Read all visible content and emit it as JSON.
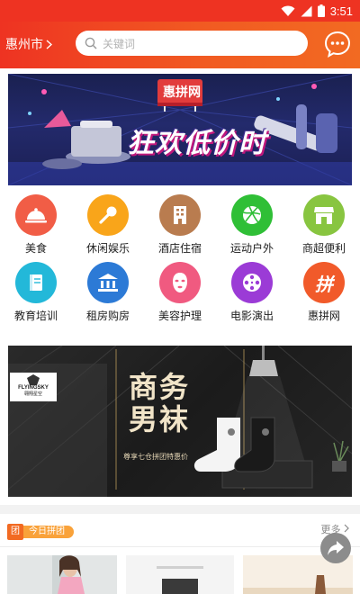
{
  "status_bar": {
    "time": "3:51"
  },
  "header": {
    "city": "惠州市",
    "search_placeholder": "关键词"
  },
  "banner_top": {
    "logo_text": "惠拼网",
    "headline": "狂欢低价时"
  },
  "categories": [
    {
      "label": "美食",
      "icon": "food-cloche-icon",
      "color": "#f15d46"
    },
    {
      "label": "休闲娱乐",
      "icon": "microphone-icon",
      "color": "#f9a51a"
    },
    {
      "label": "酒店住宿",
      "icon": "hotel-building-icon",
      "color": "#b97c4f"
    },
    {
      "label": "运动户外",
      "icon": "ball-icon",
      "color": "#2fbf36"
    },
    {
      "label": "商超便利",
      "icon": "store-icon",
      "color": "#88c540"
    },
    {
      "label": "教育培训",
      "icon": "book-icon",
      "color": "#23b8d9"
    },
    {
      "label": "租房购房",
      "icon": "bank-building-icon",
      "color": "#2c7ad6"
    },
    {
      "label": "美容护理",
      "icon": "face-mask-icon",
      "color": "#f05a80"
    },
    {
      "label": "电影演出",
      "icon": "film-reel-icon",
      "color": "#9b3bd6"
    },
    {
      "label": "惠拼网",
      "icon": "pin-logo-icon",
      "color": "#f15a2a",
      "glyph": "拼"
    }
  ],
  "banner_promo": {
    "brand": "FLYINGSKY",
    "brand_sub": "翱翔星空",
    "title_line1": "商务",
    "title_line2": "男袜",
    "subtitle": "尊享七仓拼团特惠价"
  },
  "today_section": {
    "icon_glyph": "团",
    "title": "今日拼团",
    "more": "更多"
  }
}
